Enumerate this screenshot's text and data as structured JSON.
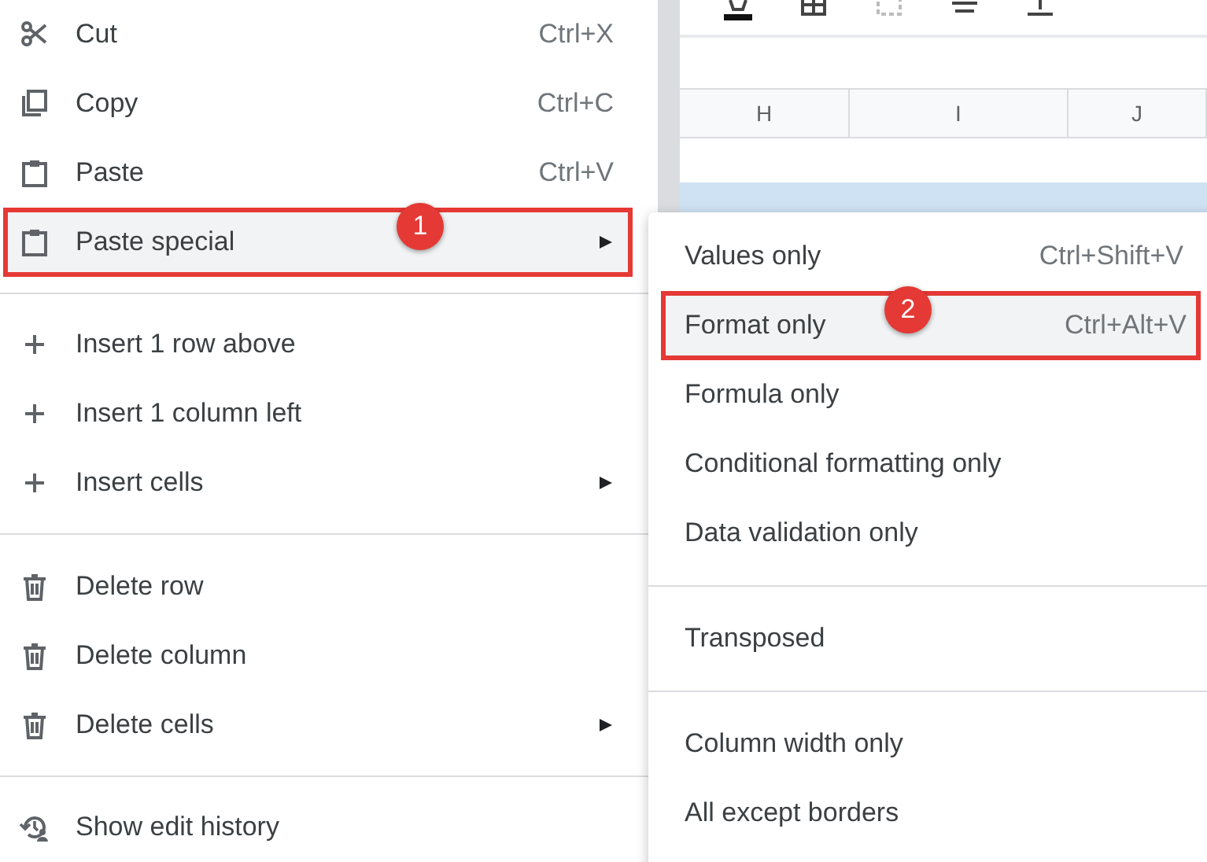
{
  "context_menu": {
    "items": [
      {
        "kind": "item",
        "label": "Cut",
        "shortcut": "Ctrl+X",
        "selected": false,
        "submenu": false
      },
      {
        "kind": "item",
        "label": "Copy",
        "shortcut": "Ctrl+C",
        "selected": false,
        "submenu": false
      },
      {
        "kind": "item",
        "label": "Paste",
        "shortcut": "Ctrl+V",
        "selected": false,
        "submenu": false
      },
      {
        "kind": "item",
        "label": "Paste special",
        "selected": true,
        "submenu": true,
        "callout": "1"
      },
      {
        "kind": "divider"
      },
      {
        "kind": "item",
        "label": "Insert 1 row above",
        "selected": false,
        "submenu": false
      },
      {
        "kind": "item",
        "label": "Insert 1 column left",
        "selected": false,
        "submenu": false
      },
      {
        "kind": "item",
        "label": "Insert cells",
        "selected": false,
        "submenu": true
      },
      {
        "kind": "divider"
      },
      {
        "kind": "item",
        "label": "Delete row",
        "selected": false,
        "submenu": false
      },
      {
        "kind": "item",
        "label": "Delete column",
        "selected": false,
        "submenu": false
      },
      {
        "kind": "item",
        "label": "Delete cells",
        "selected": false,
        "submenu": true
      },
      {
        "kind": "divider"
      },
      {
        "kind": "item",
        "label": "Show edit history",
        "selected": false,
        "submenu": false
      }
    ]
  },
  "sheet": {
    "column_headers": [
      "H",
      "I",
      "J"
    ]
  },
  "submenu": {
    "items": [
      {
        "kind": "item",
        "label": "Values only",
        "shortcut": "Ctrl+Shift+V",
        "selected": false
      },
      {
        "kind": "item",
        "label": "Format only",
        "shortcut": "Ctrl+Alt+V",
        "selected": true,
        "callout": "2"
      },
      {
        "kind": "item",
        "label": "Formula only",
        "selected": false
      },
      {
        "kind": "item",
        "label": "Conditional formatting only",
        "selected": false
      },
      {
        "kind": "item",
        "label": "Data validation only",
        "selected": false
      },
      {
        "kind": "divider"
      },
      {
        "kind": "item",
        "label": "Transposed",
        "selected": false
      },
      {
        "kind": "divider"
      },
      {
        "kind": "item",
        "label": "Column width only",
        "selected": false
      },
      {
        "kind": "item",
        "label": "All except borders",
        "selected": false
      }
    ]
  }
}
